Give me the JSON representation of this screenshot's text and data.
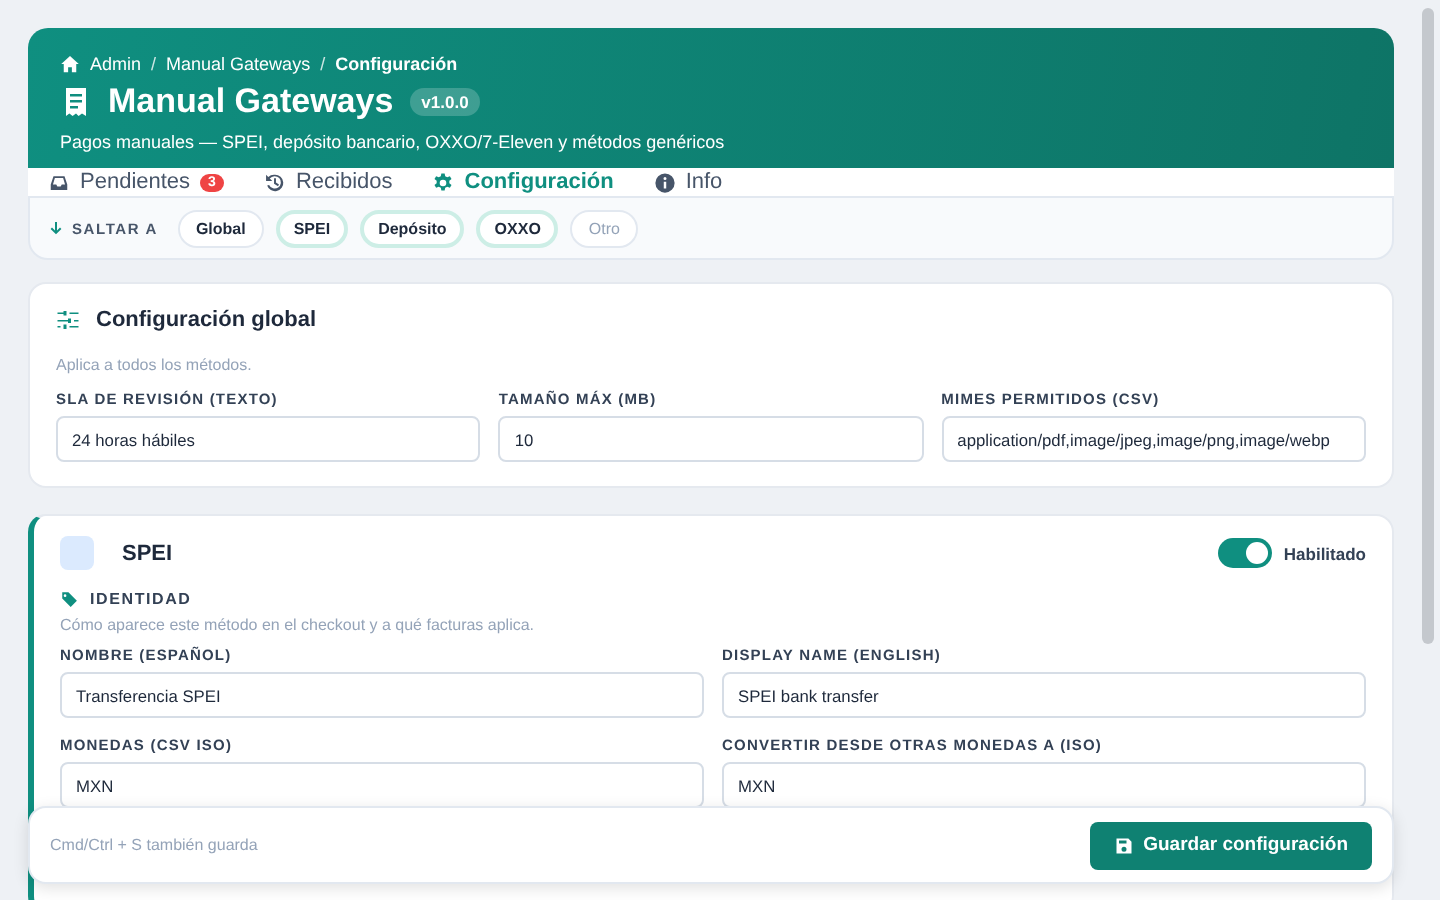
{
  "breadcrumb": [
    {
      "label": "Admin",
      "current": false
    },
    {
      "separator": "/",
      "label": "Manual Gateways",
      "current": false
    },
    {
      "separator": "/",
      "label": "Configuración",
      "current": true
    }
  ],
  "title": "Manual Gateways",
  "version": "v1.0.0",
  "subtitle": "Pagos manuales — SPEI, depósito bancario, OXXO/7-Eleven y métodos genéricos",
  "tabs": [
    {
      "label": "Pendientes",
      "badge": "3",
      "selected": false
    },
    {
      "label": "Recibidos",
      "selected": false
    },
    {
      "label": "Configuración",
      "selected": true
    },
    {
      "label": "Info",
      "selected": false
    }
  ],
  "jump": {
    "label": "SALTAR A",
    "chips": [
      {
        "label": "Global",
        "enabled": true,
        "tinted": false
      },
      {
        "label": "SPEI",
        "enabled": true,
        "tinted": true
      },
      {
        "label": "Depósito",
        "enabled": true,
        "tinted": true
      },
      {
        "label": "OXXO",
        "enabled": true,
        "tinted": true
      },
      {
        "label": "Otro",
        "enabled": false,
        "tinted": false
      }
    ]
  },
  "global": {
    "title": "Configuración global",
    "description": "Aplica a todos los métodos.",
    "fields": [
      {
        "label": "SLA DE REVISIÓN (TEXTO)",
        "value": "24 horas hábiles"
      },
      {
        "label": "TAMAÑO MÁX (MB)",
        "value": "10"
      },
      {
        "label": "MIMES PERMITIDOS (CSV)",
        "value": "application/pdf,image/jpeg,image/png,image/webp"
      }
    ]
  },
  "method": {
    "name": "SPEI",
    "enabled": true,
    "toggle_label": "Habilitado",
    "section": "IDENTIDAD",
    "section_description": "Cómo aparece este método en el checkout y a qué facturas aplica.",
    "fields": [
      {
        "label": "NOMBRE (ESPAÑOL)",
        "value": "Transferencia SPEI"
      },
      {
        "label": "DISPLAY NAME (ENGLISH)",
        "value": "SPEI bank transfer"
      },
      {
        "label": "MONEDAS (CSV ISO)",
        "value": "MXN"
      },
      {
        "label": "CONVERTIR DESDE OTRAS MONEDAS A (ISO)",
        "value": "MXN"
      }
    ]
  },
  "footer": {
    "hint": "Cmd/Ctrl + S también guarda",
    "button": "Guardar configuración"
  }
}
